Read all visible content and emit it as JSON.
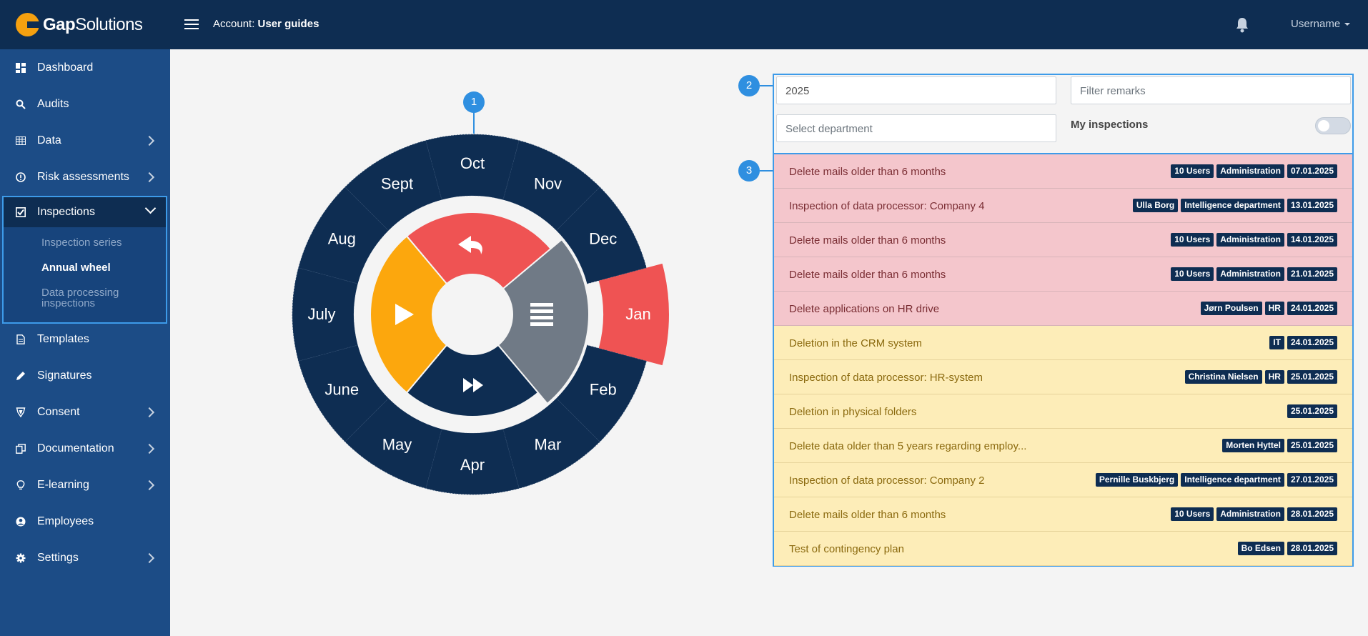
{
  "brand": {
    "name_bold": "Gap",
    "name_light": "Solutions"
  },
  "header": {
    "account_label": "Account:",
    "account_name": "User guides",
    "username": "Username"
  },
  "sidebar": {
    "items": [
      {
        "label": "Dashboard",
        "icon": "dashboard-icon"
      },
      {
        "label": "Audits",
        "icon": "search-icon"
      },
      {
        "label": "Data",
        "icon": "table-icon"
      },
      {
        "label": "Risk assessments",
        "icon": "alert-icon"
      },
      {
        "label": "Inspections",
        "icon": "checkbox-icon"
      },
      {
        "label": "Templates",
        "icon": "document-icon"
      },
      {
        "label": "Signatures",
        "icon": "pen-icon"
      },
      {
        "label": "Consent",
        "icon": "shield-icon"
      },
      {
        "label": "Documentation",
        "icon": "copy-icon"
      },
      {
        "label": "E-learning",
        "icon": "lightbulb-icon"
      },
      {
        "label": "Employees",
        "icon": "user-circle-icon"
      },
      {
        "label": "Settings",
        "icon": "gear-icon"
      }
    ],
    "sub_items": [
      "Inspection series",
      "Annual wheel",
      "Data processing inspections"
    ]
  },
  "wheel": {
    "months": [
      "Jan",
      "Feb",
      "Mar",
      "Apr",
      "May",
      "June",
      "July",
      "Aug",
      "Sept",
      "Oct",
      "Nov",
      "Dec"
    ],
    "selected_month": "Jan",
    "colors": {
      "ring": "#0e2d52",
      "selected": "#ef5353",
      "back": "#ef5353",
      "play": "#fca70d",
      "list": "#707a86",
      "forward": "#0e2d52"
    }
  },
  "callouts": [
    "1",
    "2",
    "3"
  ],
  "filters": {
    "year_value": "2025",
    "remarks_placeholder": "Filter remarks",
    "department_placeholder": "Select department",
    "my_inspections_label": "My inspections"
  },
  "inspections": [
    {
      "title": "Delete mails older than 6 months",
      "badges": [
        "10 Users",
        "Administration",
        "07.01.2025"
      ],
      "status": "red"
    },
    {
      "title": "Inspection of data processor: Company 4",
      "badges": [
        "Ulla Borg",
        "Intelligence department",
        "13.01.2025"
      ],
      "status": "red"
    },
    {
      "title": "Delete mails older than 6 months",
      "badges": [
        "10 Users",
        "Administration",
        "14.01.2025"
      ],
      "status": "red"
    },
    {
      "title": "Delete mails older than 6 months",
      "badges": [
        "10 Users",
        "Administration",
        "21.01.2025"
      ],
      "status": "red"
    },
    {
      "title": "Delete applications on HR drive",
      "badges": [
        "Jørn Poulsen",
        "HR",
        "24.01.2025"
      ],
      "status": "red"
    },
    {
      "title": "Deletion in the CRM system",
      "badges": [
        "IT",
        "24.01.2025"
      ],
      "status": "yellow"
    },
    {
      "title": "Inspection of data processor: HR-system",
      "badges": [
        "Christina Nielsen",
        "HR",
        "25.01.2025"
      ],
      "status": "yellow"
    },
    {
      "title": "Deletion in physical folders",
      "badges": [
        "25.01.2025"
      ],
      "status": "yellow"
    },
    {
      "title": "Delete data older than 5 years regarding employ...",
      "badges": [
        "Morten Hyttel",
        "25.01.2025"
      ],
      "status": "yellow"
    },
    {
      "title": "Inspection of data processor: Company 2",
      "badges": [
        "Pernille Buskbjerg",
        "Intelligence department",
        "27.01.2025"
      ],
      "status": "yellow"
    },
    {
      "title": "Delete mails older than 6 months",
      "badges": [
        "10 Users",
        "Administration",
        "28.01.2025"
      ],
      "status": "yellow"
    },
    {
      "title": "Test of contingency plan",
      "badges": [
        "Bo Edsen",
        "28.01.2025"
      ],
      "status": "yellow"
    }
  ]
}
